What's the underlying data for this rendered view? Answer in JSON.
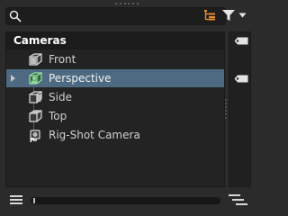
{
  "search": {
    "placeholder": "",
    "value": ""
  },
  "toolbar": {
    "hierarchy_icon": "hierarchy-icon",
    "filter_icon": "filter-icon",
    "accent_color": "#e8892f"
  },
  "panel": {
    "header": "Cameras",
    "items": [
      {
        "label": "Front",
        "icon": "camera-box-icon",
        "selected": false
      },
      {
        "label": "Perspective",
        "icon": "camera-box-green-icon",
        "selected": true,
        "expandable": true
      },
      {
        "label": "Side",
        "icon": "camera-box-icon",
        "selected": false
      },
      {
        "label": "Top",
        "icon": "camera-box-icon",
        "selected": false
      },
      {
        "label": "Rig-Shot Camera",
        "icon": "rig-camera-icon",
        "selected": false
      }
    ],
    "selection_color": "#4d6a82"
  },
  "bottom": {
    "menu_icon": "menu-icon",
    "zoom_slider_value": 0.0,
    "align_icon": "align-lines-icon"
  }
}
